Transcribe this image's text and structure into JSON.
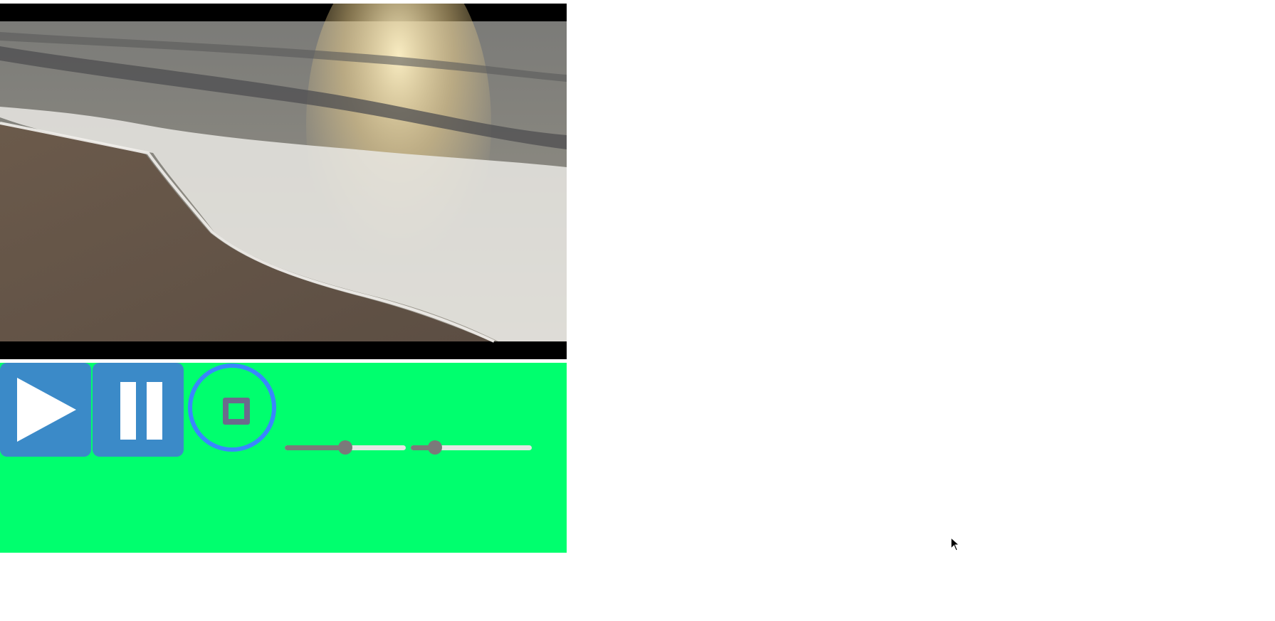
{
  "video": {
    "scene": "beach-waves-at-sunset",
    "colors": {
      "letterbox": "#000000",
      "sky_sea": "#6e6e70",
      "sun_glare": "#f4e0a8",
      "sand": "#6a5a4c",
      "foam": "#e8e6e2"
    }
  },
  "controls": {
    "background": "#00ff6e",
    "play_button": {
      "icon": "play-icon",
      "color": "#3b8ac8"
    },
    "pause_button": {
      "icon": "pause-icon",
      "color": "#3b8ac8"
    },
    "stop_button": {
      "icon": "stop-icon",
      "ring_color": "#3a86ff",
      "icon_color": "#6b6b8c"
    },
    "seek_slider": {
      "value_fraction": 0.5
    },
    "volume_slider": {
      "value_fraction": 0.2
    }
  },
  "cursor": {
    "icon": "mouse-pointer-icon"
  }
}
